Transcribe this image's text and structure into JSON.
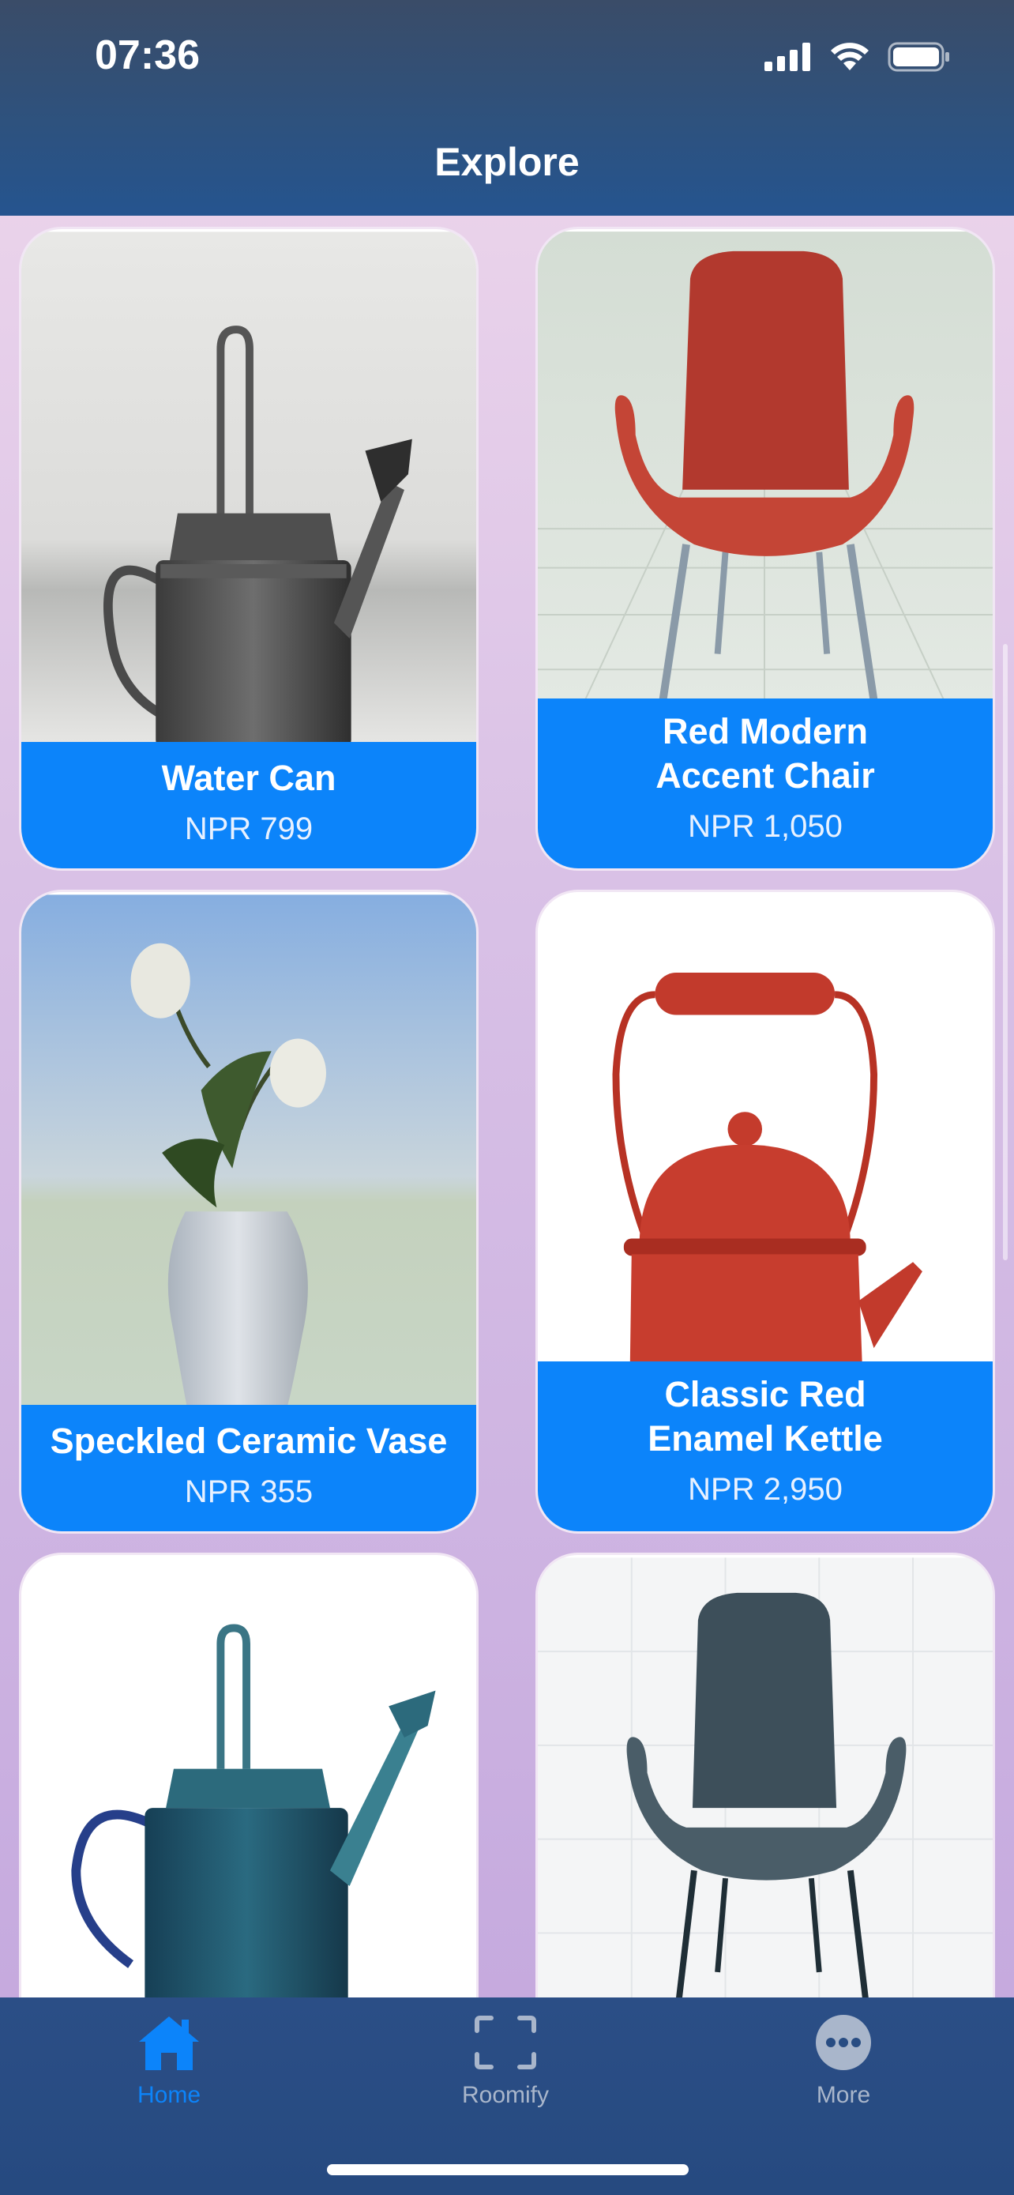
{
  "status_bar": {
    "time": "07:36"
  },
  "nav": {
    "title": "Explore"
  },
  "products": [
    {
      "name": "Water Can",
      "price": "NPR 799"
    },
    {
      "name": "Red Modern Accent Chair",
      "name_line1": "Red Modern",
      "name_line2": "Accent Chair",
      "price": "NPR 1,050"
    },
    {
      "name": "Speckled Ceramic Vase",
      "price": "NPR 355"
    },
    {
      "name": "Classic Red Enamel Kettle",
      "name_line1": "Classic Red",
      "name_line2": "Enamel Kettle",
      "price": "NPR 2,950"
    }
  ],
  "tabs": [
    {
      "label": "Home",
      "icon": "house-icon",
      "active": true
    },
    {
      "label": "Roomify",
      "icon": "scan-frame-icon",
      "active": false
    },
    {
      "label": "More",
      "icon": "ellipsis-circle-icon",
      "active": false
    }
  ],
  "colors": {
    "accent": "#0C84FA",
    "tabbar": "#284C82",
    "inactive_tab": "#A9B6CB"
  }
}
